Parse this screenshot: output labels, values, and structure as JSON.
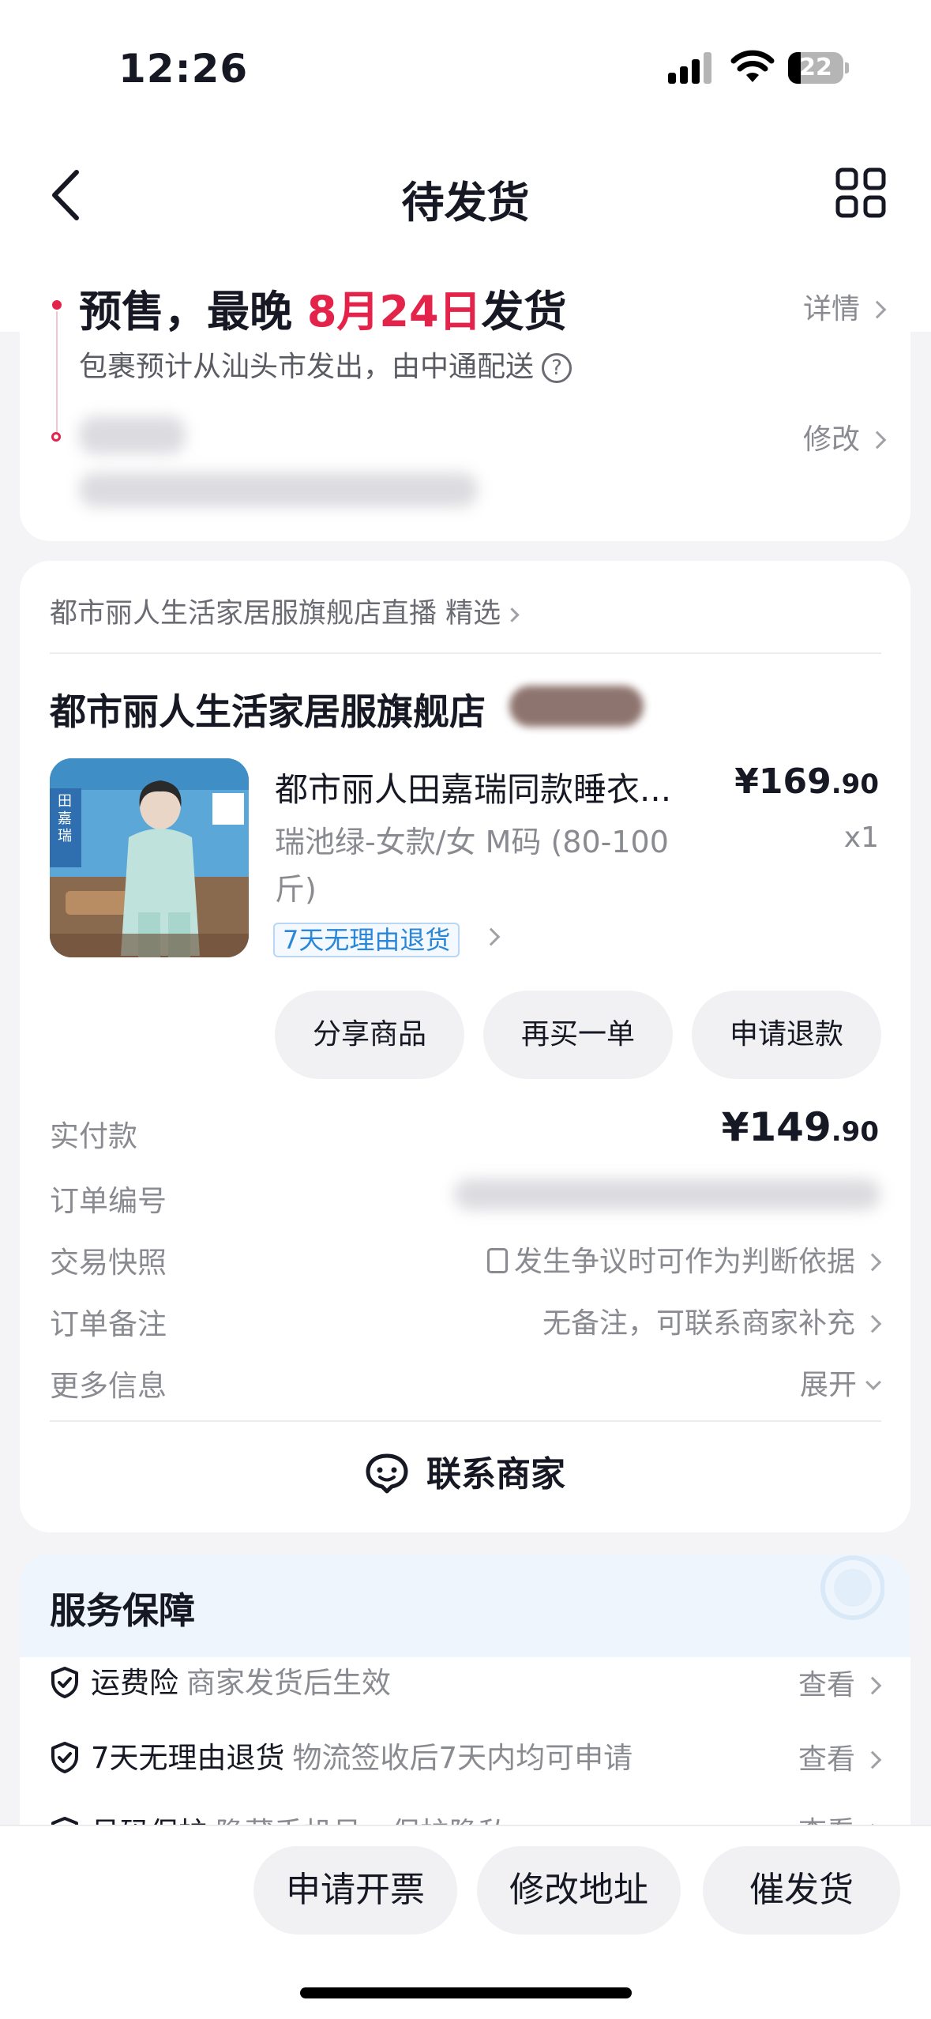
{
  "status_bar": {
    "time": "12:26",
    "battery": "22"
  },
  "nav": {
    "title": "待发货"
  },
  "shipping": {
    "title_prefix": "预售，最晚 ",
    "title_date": "8月24日",
    "title_suffix": "发货",
    "details_link": "详情",
    "subtitle": "包裹预计从汕头市发出，由中通配送",
    "edit_link": "修改"
  },
  "store": {
    "live_link": "都市丽人生活家居服旗舰店直播 精选",
    "name": "都市丽人生活家居服旗舰店"
  },
  "product": {
    "title": "都市丽人田嘉瑞同款睡衣...",
    "price_main": "¥169",
    "price_decimal": ".90",
    "spec": "瑞池绿-女款/女 M码 (80-100斤)",
    "qty": "x1",
    "return_tag": "7天无理由退货"
  },
  "product_actions": [
    "分享商品",
    "再买一单",
    "申请退款"
  ],
  "order": {
    "paid_label": "实付款",
    "paid_main": "¥149",
    "paid_decimal": ".90",
    "order_no_label": "订单编号",
    "snapshot_label": "交易快照",
    "snapshot_value": "发生争议时可作为判断依据",
    "note_label": "订单备注",
    "note_value": "无备注，可联系商家补充",
    "more_label": "更多信息",
    "more_value": "展开"
  },
  "contact": {
    "label": "联系商家"
  },
  "service": {
    "title": "服务保障",
    "rows": [
      {
        "name": "运费险",
        "desc": "商家发货后生效",
        "action": "查看"
      },
      {
        "name": "7天无理由退货",
        "desc": "物流签收后7天内均可申请",
        "action": "查看"
      },
      {
        "name": "号码保护",
        "desc": "隐藏手机号，保护隐私",
        "action": "查看"
      }
    ]
  },
  "bottom_actions": [
    "申请开票",
    "修改地址",
    "催发货"
  ],
  "colors": {
    "accent_red": "#e4234a",
    "link_blue": "#2a86d6",
    "bg": "#f4f4f6"
  }
}
